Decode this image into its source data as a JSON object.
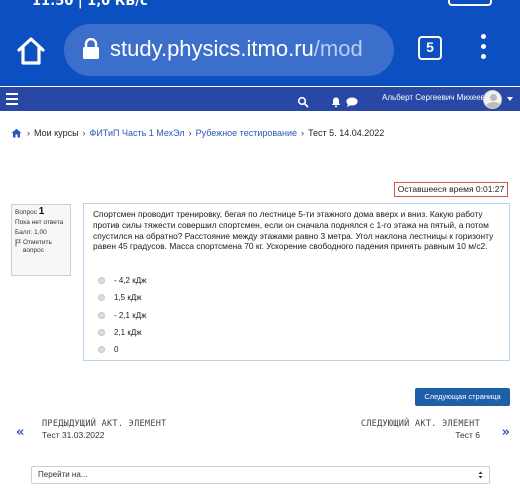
{
  "status_bar": {
    "time": "11:50 | 1,0 КБ/с"
  },
  "browser": {
    "url_host": "study.physics.itmo.ru",
    "url_path": "/mod",
    "tab_count": "5"
  },
  "navbar": {
    "user_name": "Альберт Сергеевич Михеев"
  },
  "breadcrumb": [
    {
      "label": "Мои курсы"
    },
    {
      "label": "ФИТиП Часть 1 МехЭл"
    },
    {
      "label": "Рубежное тестирование"
    },
    {
      "label": "Тест 5. 14.04.2022"
    }
  ],
  "timer": {
    "text": "Оставшееся время 0:01:27"
  },
  "question_info": {
    "label": "Вопрос",
    "number": "1",
    "status": "Пока нет ответа",
    "max_mark": "Балл: 1,00",
    "flag_label": "Отметить вопрос"
  },
  "question": {
    "text": "Спортсмен проводит тренировку, бегая по лестнице 5-ти этажного дома вверх и вниз. Какую работу против силы тяжести совершил спортсмен, если он сначала поднялся с 1-го этажа на пятый, а потом спустился на обратно? Расстояние между этажами равно 3 метра. Угол наклона лестницы к горизонту равен 45 градусов. Масса спортсмена 70 кг. Ускорение свободного падения принять равным 10 м/с2.",
    "answers": [
      {
        "label": "- 4,2 кДж"
      },
      {
        "label": "1,5 кДж"
      },
      {
        "label": "- 2,1 кДж"
      },
      {
        "label": "2,1 кДж"
      },
      {
        "label": "0"
      }
    ]
  },
  "next_page_button": "Следующая страница",
  "prev_activity": {
    "label": "ПРЕДЫДУЩИЙ АКТ. ЭЛЕМЕНТ",
    "name": "Тест 31.03.2022",
    "arrow": "«"
  },
  "next_activity": {
    "label": "СЛЕДУЮЩИЙ АКТ. ЭЛЕМЕНТ",
    "name": "Тест 6",
    "arrow": "»"
  },
  "jump_select": {
    "selected": "Перейти на..."
  },
  "colors": {
    "chrome_blue": "#0b4fc0",
    "navbar_blue": "#2948a6",
    "link_blue": "#2a58b8",
    "button_blue": "#1f5ea8",
    "timer_border": "#d9534f"
  }
}
